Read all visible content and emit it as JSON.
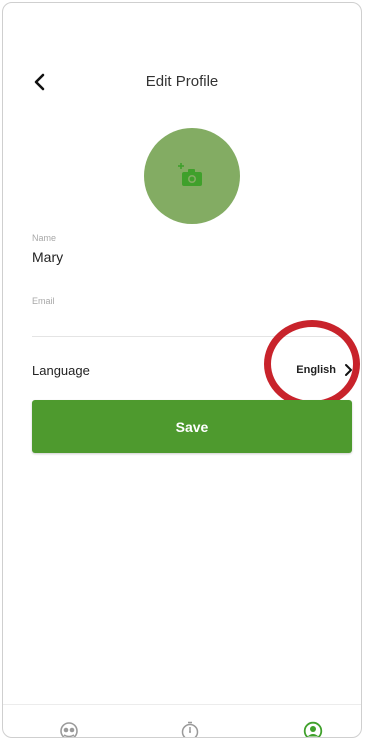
{
  "header": {
    "title": "Edit Profile",
    "back_icon": "chevron-left-icon"
  },
  "avatar": {
    "icon": "add-photo-icon",
    "color": "#83ac63",
    "icon_color": "#3fa02b"
  },
  "form": {
    "name_label": "Name",
    "name_value": "Mary",
    "email_label": "Email",
    "email_value": "",
    "language_label": "Language",
    "language_value": "English",
    "language_chevron_icon": "chevron-right-icon"
  },
  "actions": {
    "save_label": "Save",
    "save_color": "#4e9a2e"
  },
  "annotation": {
    "highlight_color": "#c8232b"
  },
  "bottom_nav": {
    "items": [
      {
        "icon": "chat-icon",
        "active": false
      },
      {
        "icon": "timer-icon",
        "active": false
      },
      {
        "icon": "profile-icon",
        "active": true
      }
    ],
    "active_color": "#3fa02b",
    "inactive_color": "#9a9a9a"
  }
}
